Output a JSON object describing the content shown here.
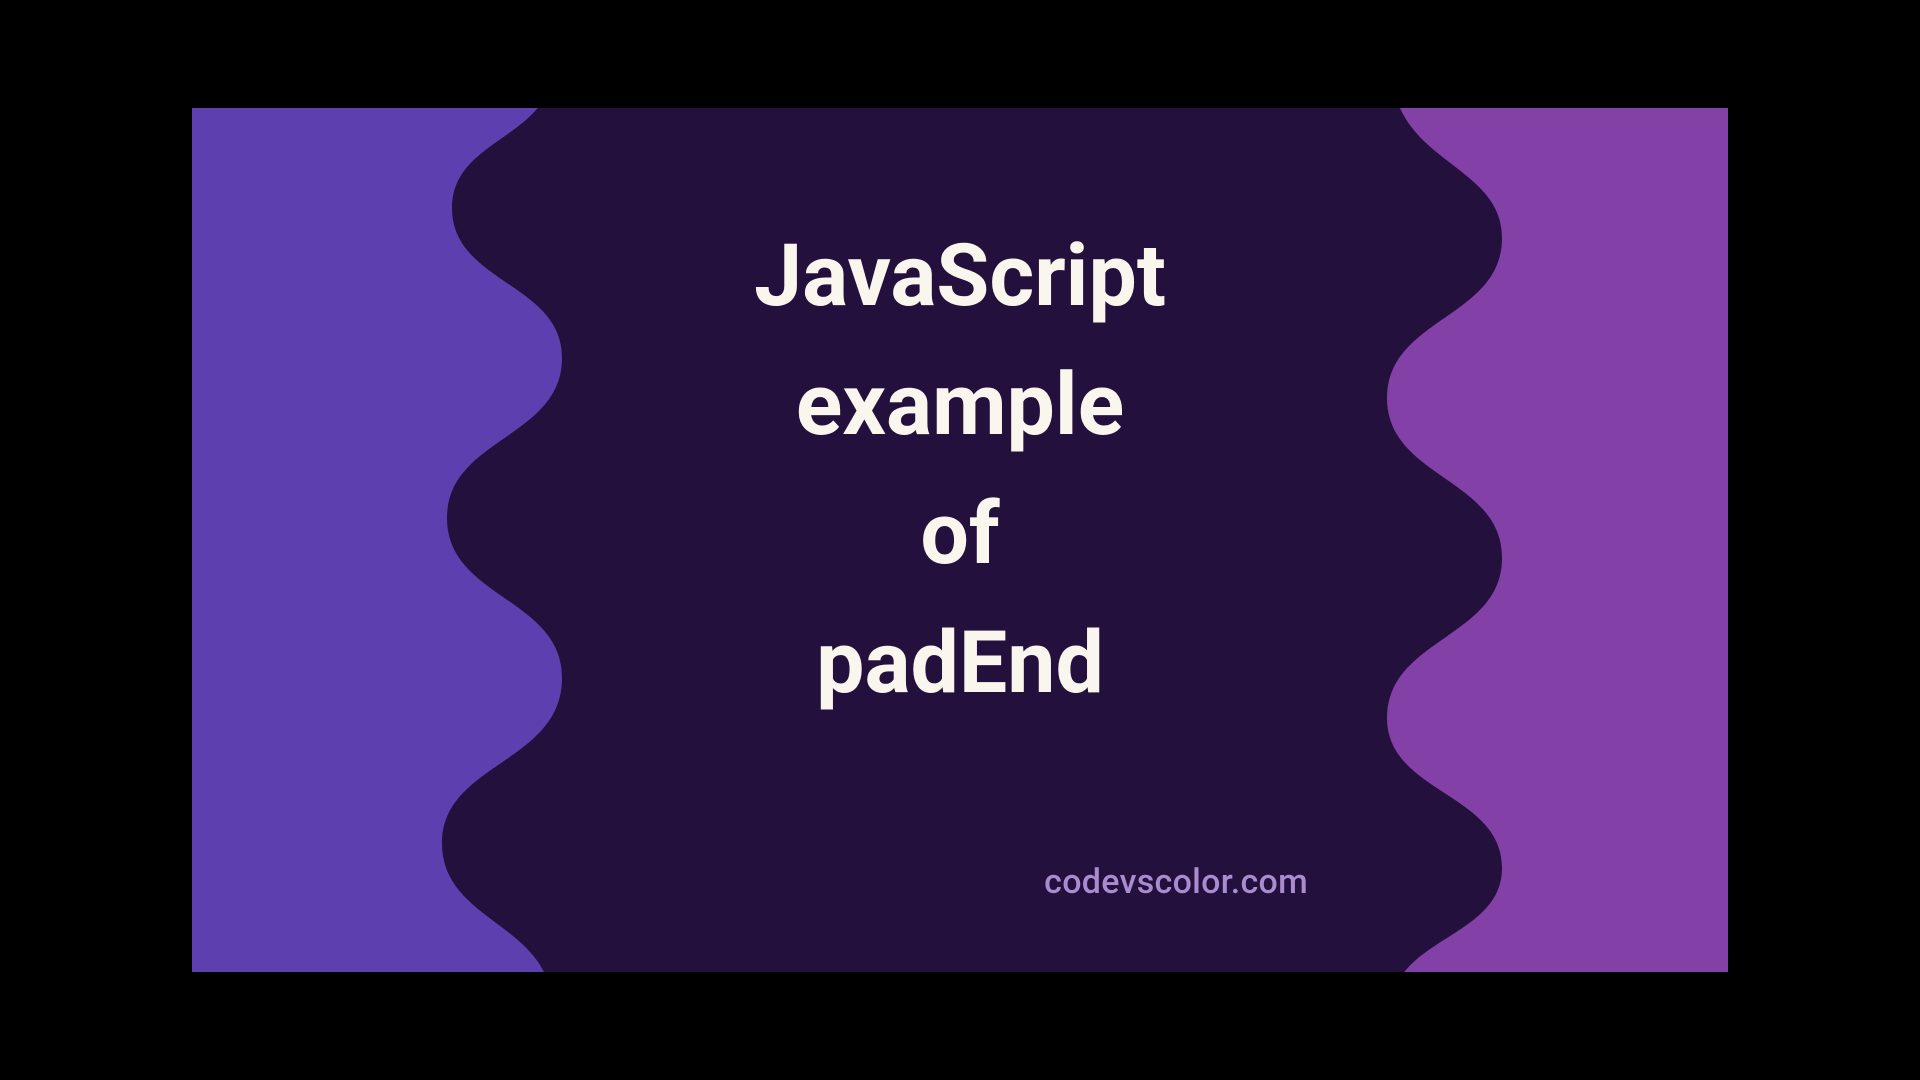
{
  "title_lines": [
    "JavaScript",
    "example",
    "of",
    "padEnd"
  ],
  "credit": "codevscolor.com",
  "colors": {
    "bg_left": "#5D3FB0",
    "bg_right": "#8340A6",
    "blob": "#24103C",
    "title_text": "#FAF6EE",
    "credit_text": "#A98BCF"
  }
}
